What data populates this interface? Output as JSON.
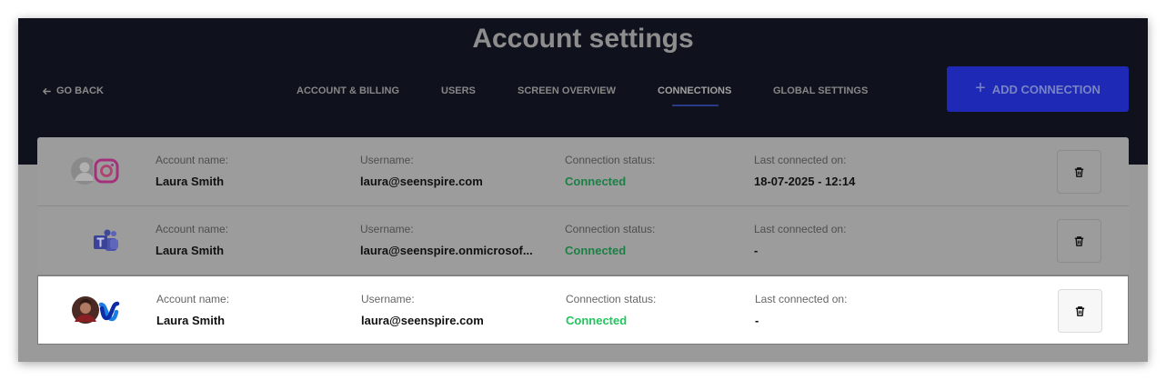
{
  "header": {
    "title": "Account settings",
    "go_back": "GO BACK",
    "tabs": [
      {
        "label": "ACCOUNT & BILLING",
        "active": false
      },
      {
        "label": "USERS",
        "active": false
      },
      {
        "label": "SCREEN OVERVIEW",
        "active": false
      },
      {
        "label": "CONNECTIONS",
        "active": true
      },
      {
        "label": "GLOBAL SETTINGS",
        "active": false
      }
    ],
    "add_button": "ADD CONNECTION",
    "add_button_icon": "plus-icon"
  },
  "labels": {
    "account_name": "Account name:",
    "username": "Username:",
    "connection_status": "Connection status:",
    "last_connected": "Last connected on:"
  },
  "connections": [
    {
      "service_icon": "instagram-icon",
      "avatar": "default-avatar",
      "account_name": "Laura Smith",
      "username": "laura@seenspire.com",
      "status": "Connected",
      "last_connected": "18-07-2025 - 12:14",
      "delete_icon": "trash-icon"
    },
    {
      "service_icon": "microsoft-teams-icon",
      "avatar": "",
      "account_name": "Laura Smith",
      "username": "laura@seenspire.onmicrosof...",
      "status": "Connected",
      "last_connected": "-",
      "delete_icon": "trash-icon"
    },
    {
      "service_icon": "webex-icon",
      "avatar": "user-photo-avatar",
      "account_name": "Laura Smith",
      "username": "laura@seenspire.com",
      "status": "Connected",
      "last_connected": "-",
      "delete_icon": "trash-icon"
    }
  ],
  "colors": {
    "header_bg": "#0f121d",
    "accent": "#1e2ab5",
    "status_connected": "#22c55e"
  }
}
